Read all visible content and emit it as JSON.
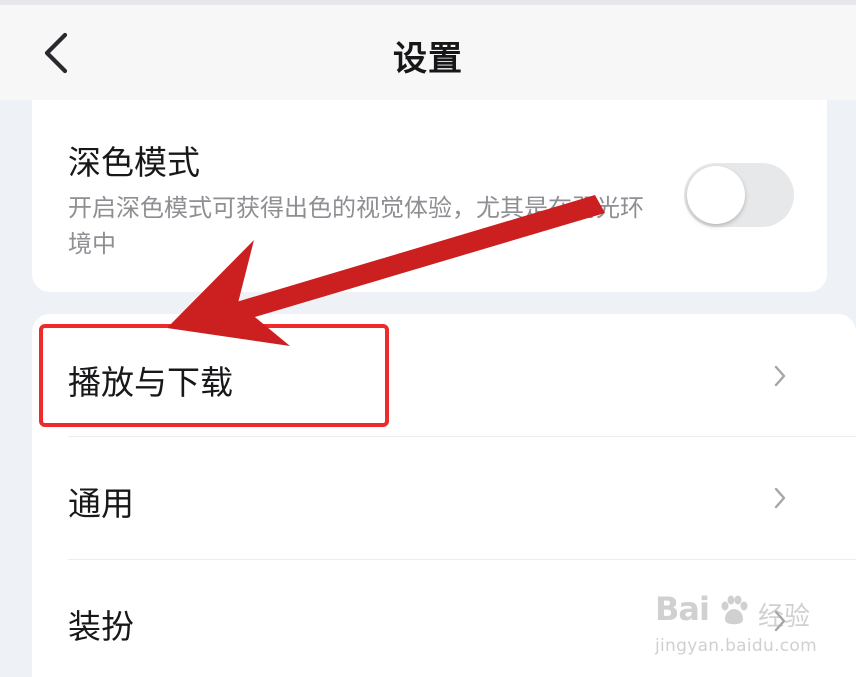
{
  "header": {
    "title": "设置",
    "back_icon": "chevron-left-icon"
  },
  "dark_mode": {
    "title": "深色模式",
    "description": "开启深色模式可获得出色的视觉体验，尤其是在弱光环境中",
    "enabled": false
  },
  "settings_list": [
    {
      "label": "播放与下载",
      "icon": "chevron-right-icon"
    },
    {
      "label": "通用",
      "icon": "chevron-right-icon"
    },
    {
      "label": "装扮",
      "icon": "chevron-right-icon"
    }
  ],
  "annotation": {
    "highlight_color": "#ee2a2a",
    "arrow_color": "#cc1f1f"
  },
  "watermark": {
    "brand": "Bai",
    "brand_suffix": "经验",
    "url": "jingyan.baidu.com"
  }
}
